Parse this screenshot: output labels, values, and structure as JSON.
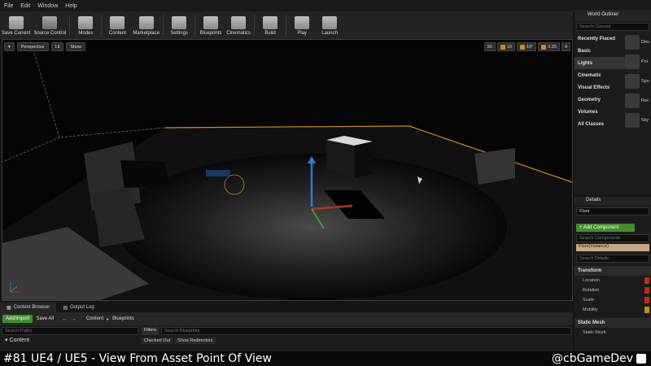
{
  "menu": [
    "File",
    "Edit",
    "Window",
    "Help"
  ],
  "toolbar": [
    {
      "label": "Save Current",
      "icon": "save-icon"
    },
    {
      "label": "Source Control",
      "icon": "source-control-icon",
      "caret": true
    },
    {
      "label": "Modes",
      "icon": "modes-icon",
      "caret": true
    },
    {
      "label": "Content",
      "icon": "content-icon"
    },
    {
      "label": "Marketplace",
      "icon": "marketplace-icon"
    },
    {
      "label": "Settings",
      "icon": "settings-icon",
      "caret": true
    },
    {
      "label": "Blueprints",
      "icon": "blueprints-icon",
      "caret": true
    },
    {
      "label": "Cinematics",
      "icon": "cinematics-icon",
      "caret": true
    },
    {
      "label": "Build",
      "icon": "build-icon",
      "caret": true
    },
    {
      "label": "Play",
      "icon": "play-icon",
      "caret": true
    },
    {
      "label": "Launch",
      "icon": "launch-icon",
      "caret": true
    }
  ],
  "viewport": {
    "buttons": [
      "Perspective",
      "Lit",
      "Show"
    ],
    "snap": [
      "10",
      "10°",
      "0.25",
      "4"
    ],
    "camera_speed": "50"
  },
  "outliner": {
    "tab": "World Outliner",
    "search_placeholder": "Search Classes",
    "categories": [
      "Recently Placed",
      "Basic",
      "Lights",
      "Cinematic",
      "Visual Effects",
      "Geometry",
      "Volumes",
      "All Classes"
    ],
    "selected_category": "Lights",
    "items": [
      "Dire",
      "Poi",
      "Spo",
      "Rec",
      "Sky"
    ]
  },
  "details": {
    "tab": "Details",
    "name_value": "Floor",
    "add_component": "+ Add Component",
    "search_components": "Search Components",
    "component": "Floor(Instance)",
    "search_details": "Search Details",
    "transform_header": "Transform",
    "rows": [
      "Location",
      "Rotation",
      "Scale",
      "Mobility"
    ],
    "static_mesh_header": "Static Mesh",
    "static_mesh_row": "Static Mesh"
  },
  "content_browser": {
    "tabs": [
      "Content Browser",
      "Output Log"
    ],
    "add_import": "Add/Import",
    "save_all": "Save All",
    "breadcrumb": [
      "Content",
      "Blueprints"
    ],
    "search_paths": "Search Paths",
    "tree_root": "Content",
    "filters": "Filters",
    "search_blueprints": "Search Blueprints",
    "filter_chips": [
      "Checked Out",
      "Show Redirectors"
    ]
  },
  "caption": {
    "title": "#81 UE4 / UE5 - View From Asset Point Of View",
    "handle": "@cbGameDev"
  },
  "colors": {
    "accent": "#d28a15",
    "green": "#3f8f2a",
    "selection": "#c6a788"
  }
}
